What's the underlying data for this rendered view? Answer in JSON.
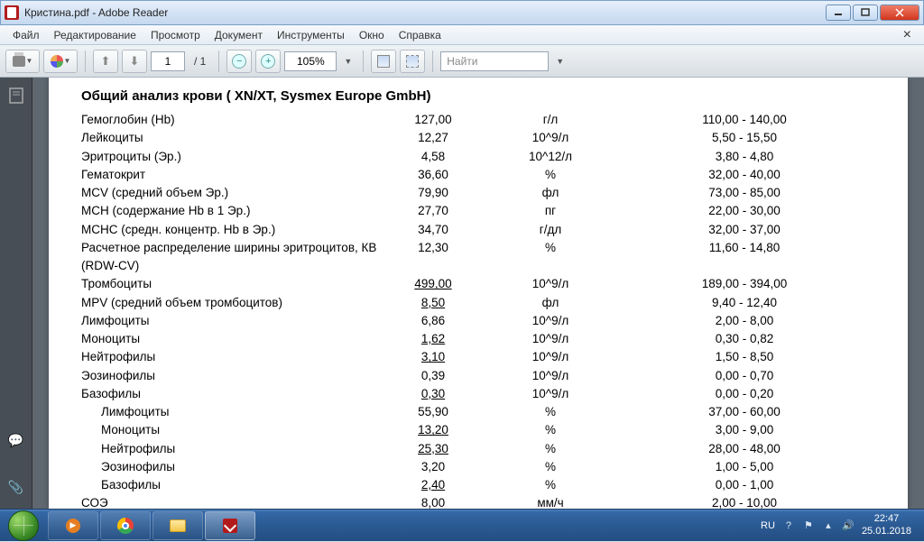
{
  "window": {
    "title": "Кристина.pdf - Adobe Reader"
  },
  "menu": {
    "items": [
      "Файл",
      "Редактирование",
      "Просмотр",
      "Документ",
      "Инструменты",
      "Окно",
      "Справка"
    ],
    "close": "×"
  },
  "toolbar": {
    "page_current": "1",
    "page_total": "/ 1",
    "zoom": "105%",
    "find_placeholder": "Найти"
  },
  "doc": {
    "title": "Общий анализ крови ( XN/XT, Sysmex  Europe GmbH)",
    "rows": [
      {
        "name": "Гемоглобин (Hb)",
        "val": "127,00",
        "unit": "г/л",
        "range": "110,00 - 140,00"
      },
      {
        "name": "Лейкоциты",
        "val": "12,27",
        "unit": "10^9/л",
        "range": "5,50 - 15,50"
      },
      {
        "name": "Эритроциты (Эр.)",
        "val": "4,58",
        "unit": "10^12/л",
        "range": "3,80 - 4,80"
      },
      {
        "name": "Гематокрит",
        "val": "36,60",
        "unit": "%",
        "range": "32,00 - 40,00"
      },
      {
        "name": "MCV (средний объем Эр.)",
        "val": "79,90",
        "unit": "фл",
        "range": "73,00 - 85,00"
      },
      {
        "name": "MCH (содержание Hb в 1 Эр.)",
        "val": "27,70",
        "unit": "пг",
        "range": "22,00 - 30,00"
      },
      {
        "name": "MCHC (средн. концентр. Hb в Эр.)",
        "val": "34,70",
        "unit": "г/дл",
        "range": "32,00 - 37,00"
      },
      {
        "name": "Расчетное распределение ширины эритроцитов, КВ (RDW-CV)",
        "val": "12,30",
        "unit": "%",
        "range": "11,60 - 14,80"
      },
      {
        "name": "Тромбоциты",
        "val": "499,00",
        "under": true,
        "unit": "10^9/л",
        "range": "189,00 - 394,00"
      },
      {
        "name": "MPV (средний объем тромбоцитов)",
        "val": "8,50",
        "under": true,
        "unit": "фл",
        "range": "9,40 - 12,40"
      },
      {
        "name": "Лимфоциты",
        "val": "6,86",
        "unit": "10^9/л",
        "range": "2,00 - 8,00"
      },
      {
        "name": "Моноциты",
        "val": "1,62",
        "under": true,
        "unit": "10^9/л",
        "range": "0,30 - 0,82"
      },
      {
        "name": "Нейтрофилы",
        "val": "3,10",
        "under": true,
        "unit": "10^9/л",
        "range": "1,50 - 8,50"
      },
      {
        "name": "Эозинофилы",
        "val": "0,39",
        "unit": "10^9/л",
        "range": "0,00 - 0,70"
      },
      {
        "name": "Базофилы",
        "val": "0,30",
        "under": true,
        "unit": "10^9/л",
        "range": "0,00 - 0,20"
      },
      {
        "name": "Лимфоциты",
        "indent": true,
        "val": "55,90",
        "unit": "%",
        "range": "37,00 - 60,00"
      },
      {
        "name": "Моноциты",
        "indent": true,
        "val": "13,20",
        "under": true,
        "unit": "%",
        "range": "3,00 - 9,00"
      },
      {
        "name": "Нейтрофилы",
        "indent": true,
        "val": "25,30",
        "under": true,
        "unit": "%",
        "range": "28,00 - 48,00"
      },
      {
        "name": "Эозинофилы",
        "indent": true,
        "val": "3,20",
        "unit": "%",
        "range": "1,00 - 5,00"
      },
      {
        "name": "Базофилы",
        "indent": true,
        "val": "2,40",
        "under": true,
        "unit": "%",
        "range": "0,00 - 1,00"
      },
      {
        "name": "СОЭ",
        "val": "8,00",
        "unit": "мм/ч",
        "range": "2,00 - 10,00"
      }
    ]
  },
  "tray": {
    "lang": "RU",
    "time": "22:47",
    "date": "25.01.2018"
  }
}
